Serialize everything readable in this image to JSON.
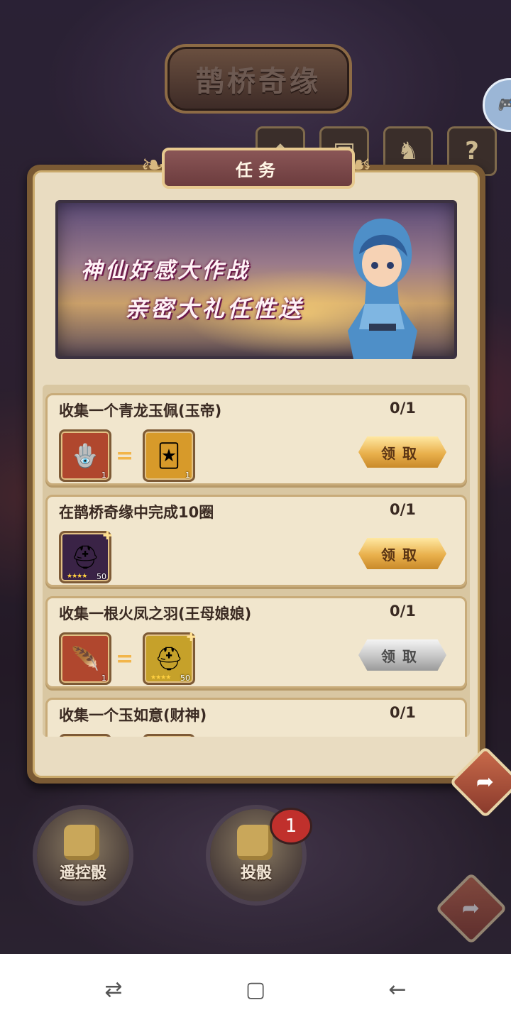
{
  "game": {
    "logo_text": "鹊桥奇缘"
  },
  "panel": {
    "title": "任务",
    "banner": {
      "line1": "神仙好感大作战",
      "line2": "亲密大礼任性送"
    }
  },
  "tasks": [
    {
      "title": "收集一个青龙玉佩(玉帝)",
      "progress": "0/1",
      "requires": {
        "icon": "jade-pendant-icon",
        "qty": "1"
      },
      "equals": "=",
      "reward": {
        "icon": "golden-card-icon",
        "qty": "1"
      },
      "claim_label": "领取",
      "claim_state": "gold"
    },
    {
      "title": "在鹊桥奇缘中完成10圈",
      "progress": "0/1",
      "reward": {
        "icon": "black-helmet-icon",
        "qty": "50",
        "stars": "★★★★"
      },
      "claim_label": "领取",
      "claim_state": "gold"
    },
    {
      "title": "收集一根火凤之羽(王母娘娘)",
      "progress": "0/1",
      "requires": {
        "icon": "phoenix-feather-icon",
        "qty": "1"
      },
      "equals": "=",
      "reward": {
        "icon": "black-helmet-icon",
        "qty": "50",
        "stars": "★★★★"
      },
      "claim_label": "领取",
      "claim_state": "gray"
    },
    {
      "title": "收集一个玉如意(财神)",
      "progress": "0/1"
    }
  ],
  "bottom": {
    "remote_dice_label": "遥控骰",
    "roll_dice_label": "投骰",
    "roll_badge": "1"
  },
  "colors": {
    "claim_gold": "#e9b04c",
    "claim_gray": "#c6c6c6",
    "title_plate": "#7a4648",
    "badge": "#c0302c"
  }
}
